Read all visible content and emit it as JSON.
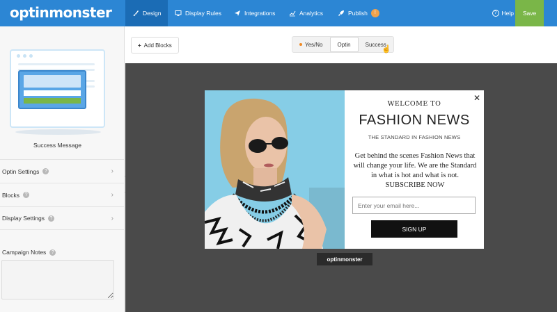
{
  "header": {
    "logo_text": "optinmonster",
    "nav": [
      {
        "label": "Design",
        "icon": "brush-icon"
      },
      {
        "label": "Display Rules",
        "icon": "monitor-icon"
      },
      {
        "label": "Integrations",
        "icon": "plane-icon"
      },
      {
        "label": "Analytics",
        "icon": "chart-icon"
      },
      {
        "label": "Publish",
        "icon": "rocket-icon",
        "badge": "!"
      }
    ],
    "help_label": "Help",
    "save_label": "Save",
    "colors": {
      "bar": "#2c86d4",
      "active": "#1b6cb5",
      "save": "#7ab648"
    }
  },
  "sidebar": {
    "preview_label": "Success Message",
    "items": [
      {
        "label": "Optin Settings"
      },
      {
        "label": "Blocks"
      },
      {
        "label": "Display Settings"
      }
    ],
    "notes_label": "Campaign Notes"
  },
  "toolbar": {
    "add_blocks_label": "Add Blocks",
    "view_tabs": [
      "Yes/No",
      "Optin",
      "Success"
    ],
    "active_view": "Optin"
  },
  "popup": {
    "welcome": "WELCOME TO",
    "headline": "FASHION NEWS",
    "tagline": "THE STANDARD IN FASHION NEWS",
    "body": "Get behind the scenes Fashion News that will change your life. We are the Standard in what is hot and what is not. SUBSCRIBE NOW",
    "email_placeholder": "Enter your email here...",
    "button_label": "SIGN UP",
    "close": "✕"
  },
  "canvas": {
    "powered_by": "optinmonster"
  }
}
